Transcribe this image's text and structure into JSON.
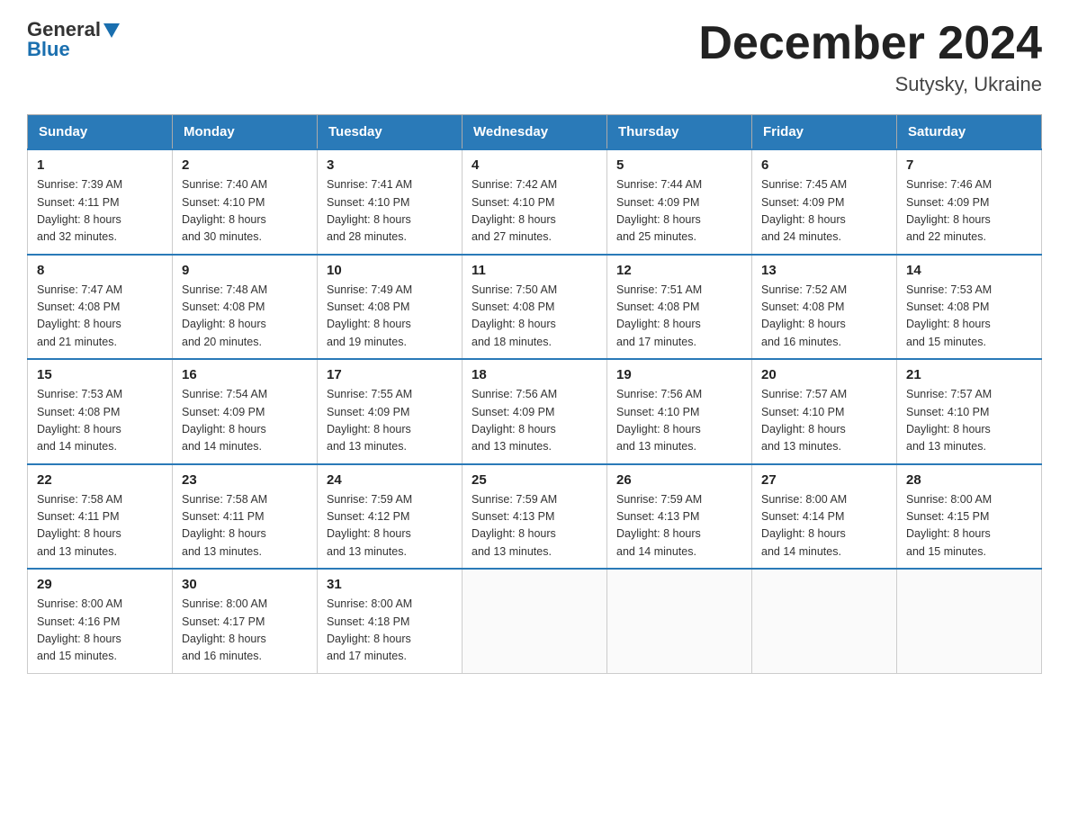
{
  "header": {
    "logo_general": "General",
    "logo_blue": "Blue",
    "title": "December 2024",
    "subtitle": "Sutysky, Ukraine"
  },
  "weekdays": [
    "Sunday",
    "Monday",
    "Tuesday",
    "Wednesday",
    "Thursday",
    "Friday",
    "Saturday"
  ],
  "weeks": [
    [
      {
        "day": "1",
        "info": "Sunrise: 7:39 AM\nSunset: 4:11 PM\nDaylight: 8 hours\nand 32 minutes."
      },
      {
        "day": "2",
        "info": "Sunrise: 7:40 AM\nSunset: 4:10 PM\nDaylight: 8 hours\nand 30 minutes."
      },
      {
        "day": "3",
        "info": "Sunrise: 7:41 AM\nSunset: 4:10 PM\nDaylight: 8 hours\nand 28 minutes."
      },
      {
        "day": "4",
        "info": "Sunrise: 7:42 AM\nSunset: 4:10 PM\nDaylight: 8 hours\nand 27 minutes."
      },
      {
        "day": "5",
        "info": "Sunrise: 7:44 AM\nSunset: 4:09 PM\nDaylight: 8 hours\nand 25 minutes."
      },
      {
        "day": "6",
        "info": "Sunrise: 7:45 AM\nSunset: 4:09 PM\nDaylight: 8 hours\nand 24 minutes."
      },
      {
        "day": "7",
        "info": "Sunrise: 7:46 AM\nSunset: 4:09 PM\nDaylight: 8 hours\nand 22 minutes."
      }
    ],
    [
      {
        "day": "8",
        "info": "Sunrise: 7:47 AM\nSunset: 4:08 PM\nDaylight: 8 hours\nand 21 minutes."
      },
      {
        "day": "9",
        "info": "Sunrise: 7:48 AM\nSunset: 4:08 PM\nDaylight: 8 hours\nand 20 minutes."
      },
      {
        "day": "10",
        "info": "Sunrise: 7:49 AM\nSunset: 4:08 PM\nDaylight: 8 hours\nand 19 minutes."
      },
      {
        "day": "11",
        "info": "Sunrise: 7:50 AM\nSunset: 4:08 PM\nDaylight: 8 hours\nand 18 minutes."
      },
      {
        "day": "12",
        "info": "Sunrise: 7:51 AM\nSunset: 4:08 PM\nDaylight: 8 hours\nand 17 minutes."
      },
      {
        "day": "13",
        "info": "Sunrise: 7:52 AM\nSunset: 4:08 PM\nDaylight: 8 hours\nand 16 minutes."
      },
      {
        "day": "14",
        "info": "Sunrise: 7:53 AM\nSunset: 4:08 PM\nDaylight: 8 hours\nand 15 minutes."
      }
    ],
    [
      {
        "day": "15",
        "info": "Sunrise: 7:53 AM\nSunset: 4:08 PM\nDaylight: 8 hours\nand 14 minutes."
      },
      {
        "day": "16",
        "info": "Sunrise: 7:54 AM\nSunset: 4:09 PM\nDaylight: 8 hours\nand 14 minutes."
      },
      {
        "day": "17",
        "info": "Sunrise: 7:55 AM\nSunset: 4:09 PM\nDaylight: 8 hours\nand 13 minutes."
      },
      {
        "day": "18",
        "info": "Sunrise: 7:56 AM\nSunset: 4:09 PM\nDaylight: 8 hours\nand 13 minutes."
      },
      {
        "day": "19",
        "info": "Sunrise: 7:56 AM\nSunset: 4:10 PM\nDaylight: 8 hours\nand 13 minutes."
      },
      {
        "day": "20",
        "info": "Sunrise: 7:57 AM\nSunset: 4:10 PM\nDaylight: 8 hours\nand 13 minutes."
      },
      {
        "day": "21",
        "info": "Sunrise: 7:57 AM\nSunset: 4:10 PM\nDaylight: 8 hours\nand 13 minutes."
      }
    ],
    [
      {
        "day": "22",
        "info": "Sunrise: 7:58 AM\nSunset: 4:11 PM\nDaylight: 8 hours\nand 13 minutes."
      },
      {
        "day": "23",
        "info": "Sunrise: 7:58 AM\nSunset: 4:11 PM\nDaylight: 8 hours\nand 13 minutes."
      },
      {
        "day": "24",
        "info": "Sunrise: 7:59 AM\nSunset: 4:12 PM\nDaylight: 8 hours\nand 13 minutes."
      },
      {
        "day": "25",
        "info": "Sunrise: 7:59 AM\nSunset: 4:13 PM\nDaylight: 8 hours\nand 13 minutes."
      },
      {
        "day": "26",
        "info": "Sunrise: 7:59 AM\nSunset: 4:13 PM\nDaylight: 8 hours\nand 14 minutes."
      },
      {
        "day": "27",
        "info": "Sunrise: 8:00 AM\nSunset: 4:14 PM\nDaylight: 8 hours\nand 14 minutes."
      },
      {
        "day": "28",
        "info": "Sunrise: 8:00 AM\nSunset: 4:15 PM\nDaylight: 8 hours\nand 15 minutes."
      }
    ],
    [
      {
        "day": "29",
        "info": "Sunrise: 8:00 AM\nSunset: 4:16 PM\nDaylight: 8 hours\nand 15 minutes."
      },
      {
        "day": "30",
        "info": "Sunrise: 8:00 AM\nSunset: 4:17 PM\nDaylight: 8 hours\nand 16 minutes."
      },
      {
        "day": "31",
        "info": "Sunrise: 8:00 AM\nSunset: 4:18 PM\nDaylight: 8 hours\nand 17 minutes."
      },
      {
        "day": "",
        "info": ""
      },
      {
        "day": "",
        "info": ""
      },
      {
        "day": "",
        "info": ""
      },
      {
        "day": "",
        "info": ""
      }
    ]
  ]
}
